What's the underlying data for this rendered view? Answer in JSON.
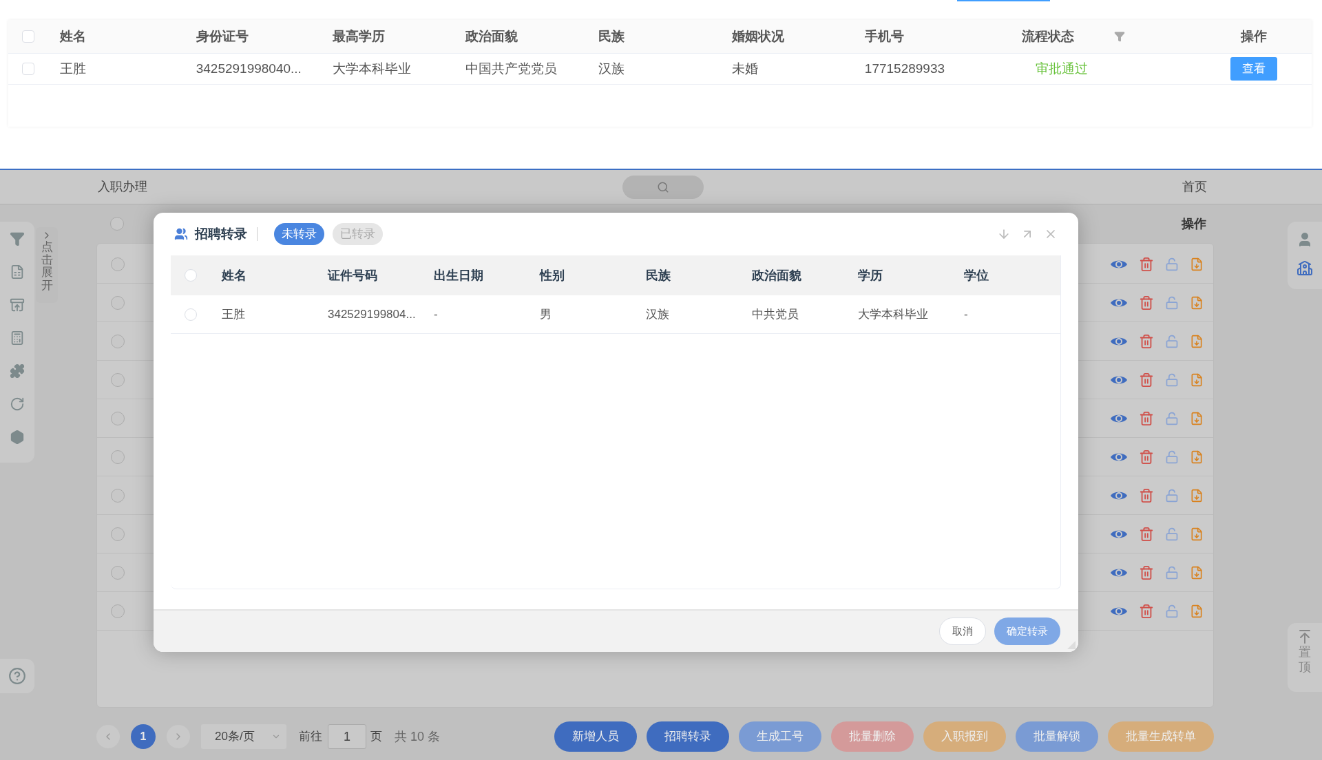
{
  "top_table": {
    "header_checked": false,
    "columns": [
      "姓名",
      "身份证号",
      "最高学历",
      "政治面貌",
      "民族",
      "婚姻状况",
      "手机号",
      "流程状态",
      "操作"
    ],
    "rows": [
      {
        "checked": false,
        "cells": [
          "王胜",
          "3425291998040...",
          "大学本科毕业",
          "中国共产党党员",
          "汉族",
          "未婚",
          "17715289933"
        ],
        "status": "审批通过",
        "action": "查看"
      }
    ]
  },
  "background_page": {
    "breadcrumb": "入职办理",
    "home": "首页",
    "expand_label": "点击展开",
    "action_column": "操作",
    "header_checked": false,
    "rows": [
      {
        "checked": false
      },
      {
        "checked": false
      },
      {
        "checked": false
      },
      {
        "checked": false
      },
      {
        "checked": false
      },
      {
        "checked": false
      },
      {
        "checked": false
      },
      {
        "checked": false
      },
      {
        "checked": false
      },
      {
        "checked": false
      }
    ],
    "back_to_top": "置顶",
    "pagination": {
      "pages": [
        {
          "label": "1",
          "selected": true
        }
      ],
      "page_size": "20条/页",
      "goto_label": "前往",
      "goto_value": "1",
      "page_unit": "页",
      "total": "共 10 条"
    },
    "buttons": [
      {
        "label": "新增人员",
        "color": "#3f6cbf"
      },
      {
        "label": "招聘转录",
        "color": "#3f6cbf"
      },
      {
        "label": "生成工号",
        "color": "#7a9bd4"
      },
      {
        "label": "批量删除",
        "color": "#d49a9a"
      },
      {
        "label": "入职报到",
        "color": "#d6ad7b"
      },
      {
        "label": "批量解锁",
        "color": "#7a9bd4"
      },
      {
        "label": "批量生成转单",
        "color": "#d6ad7b"
      }
    ]
  },
  "modal": {
    "title": "招聘转录",
    "tabs": [
      {
        "label": "未转录",
        "selected": true
      },
      {
        "label": "已转录",
        "selected": false
      }
    ],
    "header_checked": false,
    "columns": [
      "姓名",
      "证件号码",
      "出生日期",
      "性别",
      "民族",
      "政治面貌",
      "学历",
      "学位"
    ],
    "rows": [
      {
        "checked": false,
        "cells": [
          "王胜",
          "342529199804...",
          "-",
          "男",
          "汉族",
          "中共党员",
          "大学本科毕业",
          "-"
        ]
      }
    ],
    "cancel": "取消",
    "confirm": {
      "label": "确定转录",
      "disabled": true
    }
  }
}
